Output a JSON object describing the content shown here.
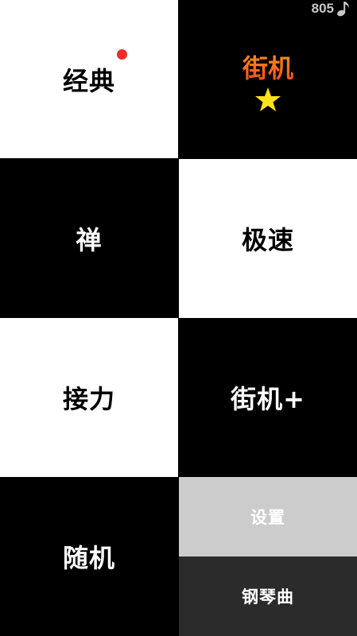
{
  "score": {
    "value": "805",
    "icon": "music-note-icon"
  },
  "tiles": {
    "classic": {
      "label": "经典",
      "badge": "red-dot"
    },
    "arcade": {
      "label": "街机",
      "icon": "star-icon",
      "label_color": "#ff7a1a",
      "star_color": "#ffe21a"
    },
    "zen": {
      "label": "禅"
    },
    "speed": {
      "label": "极速"
    },
    "relay": {
      "label": "接力"
    },
    "arcade_plus": {
      "label": "街机+"
    },
    "random": {
      "label": "随机"
    },
    "settings": {
      "label": "设置",
      "bg": "#cccccc"
    },
    "piano": {
      "label": "钢琴曲",
      "bg": "#2b2b2b"
    }
  }
}
